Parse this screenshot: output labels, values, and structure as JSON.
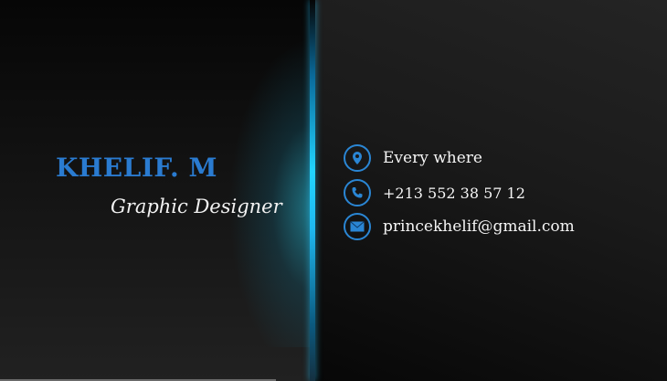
{
  "card": {
    "name": "KHELIF. M",
    "job_title": "Graphic Designer",
    "contacts": [
      {
        "icon": "location-pin-icon",
        "text": "Every where"
      },
      {
        "icon": "phone-icon",
        "text": "+213 552 38 57 12"
      },
      {
        "icon": "envelope-icon",
        "text": "princekhelif@gmail.com"
      }
    ],
    "colors": {
      "accent": "#2a7bd0",
      "glow": "#22d4ff"
    }
  }
}
